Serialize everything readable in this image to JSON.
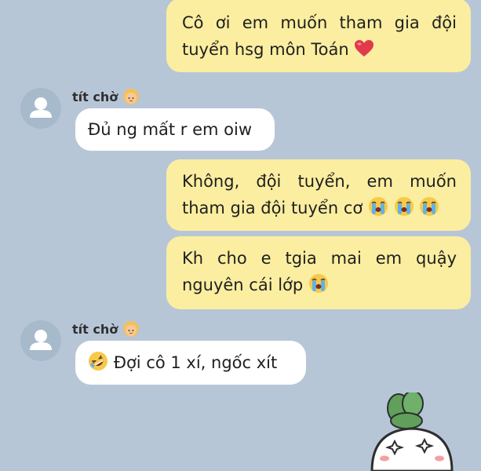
{
  "messages": [
    {
      "direction": "outgoing",
      "text": "Cô ơi em muốn tham gia đội tuyển hsg môn Toán",
      "emoji": "heart-emoji"
    },
    {
      "direction": "incoming",
      "sender": "tít chờ",
      "sender_emoji": "blonde-person-emoji",
      "text": "Đủ ng mất r em oiw"
    },
    {
      "direction": "outgoing",
      "text": "Không, đội tuyển, em muốn tham gia đội tuyển cơ",
      "emoji": "crying-face-emoji x3"
    },
    {
      "direction": "outgoing",
      "text": "Kh cho e tgia mai em quậy nguyên cái lớp",
      "emoji": "crying-face-emoji"
    },
    {
      "direction": "incoming",
      "sender": "tít chờ",
      "sender_emoji": "blonde-person-emoji",
      "text": "Đợi cô 1 xí, ngốc xít",
      "leading_emoji": "rolling-laughing-emoji"
    }
  ],
  "sticker": "radish-sticker-starry-eyes",
  "colors": {
    "background": "#b7c6d7",
    "outgoing_bubble": "#fbeea0",
    "incoming_bubble": "#ffffff",
    "avatar": "#a6bacb"
  }
}
